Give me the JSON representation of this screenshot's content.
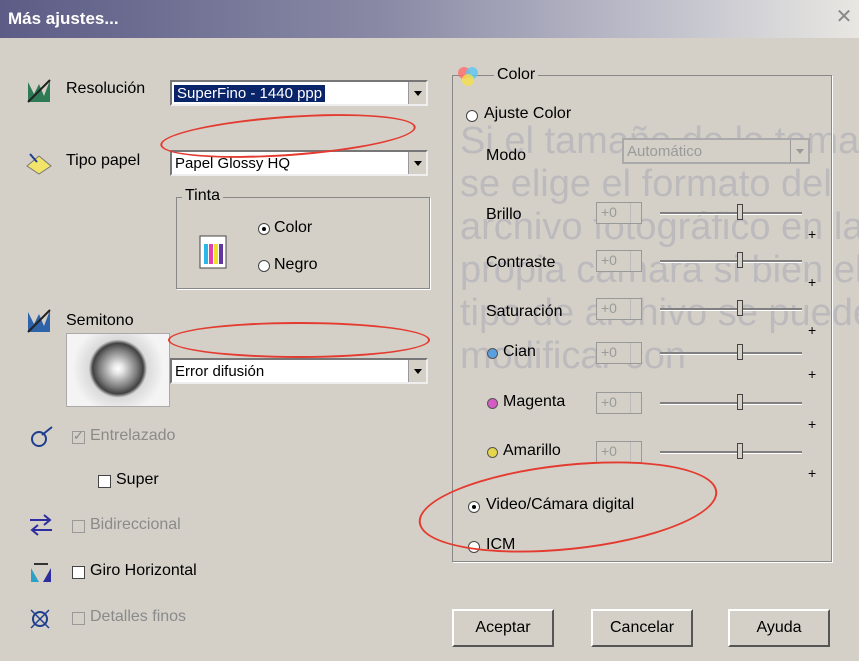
{
  "window": {
    "title": "Más ajustes...",
    "close": "✕"
  },
  "left": {
    "resolution": {
      "label": "Resolución",
      "value": "SuperFino - 1440 ppp"
    },
    "paper": {
      "label": "Tipo papel",
      "value": "Papel Glossy HQ"
    },
    "ink": {
      "title": "Tinta",
      "color": "Color",
      "black": "Negro",
      "selected": "color"
    },
    "halftone": {
      "label": "Semitono",
      "value": "Error difusión"
    },
    "interleave": {
      "label": "Entrelazado",
      "checked": true,
      "enabled": false
    },
    "super": {
      "label": "Super",
      "checked": false
    },
    "bidirectional": {
      "label": "Bidireccional",
      "checked": false,
      "enabled": false
    },
    "flip": {
      "label": "Giro Horizontal",
      "checked": false
    },
    "fine_detail": {
      "label": "Detalles finos",
      "checked": false,
      "enabled": false
    }
  },
  "color": {
    "title": "Color",
    "adjust_label": "Ajuste Color",
    "mode_label": "Modo",
    "mode_value": "Automático",
    "sliders": [
      {
        "label": "Brillo",
        "value": "+0"
      },
      {
        "label": "Contraste",
        "value": "+0"
      },
      {
        "label": "Saturación",
        "value": "+0"
      },
      {
        "label": "Cian",
        "value": "+0",
        "color": "#5aa0e0"
      },
      {
        "label": "Magenta",
        "value": "+0",
        "color": "#d65bc4"
      },
      {
        "label": "Amarillo",
        "value": "+0",
        "color": "#e6d64c"
      }
    ],
    "plus": "+",
    "video_label": "Video/Cámara digital",
    "icm_label": "ICM",
    "selected": "video"
  },
  "buttons": {
    "ok": "Aceptar",
    "cancel": "Cancelar",
    "help": "Ayuda"
  },
  "background_text": "Si el tamaño de lo toma se elige el formato del archivo fotográfico en la propia cámara si bien el tipo de archivo se puede modificar con"
}
